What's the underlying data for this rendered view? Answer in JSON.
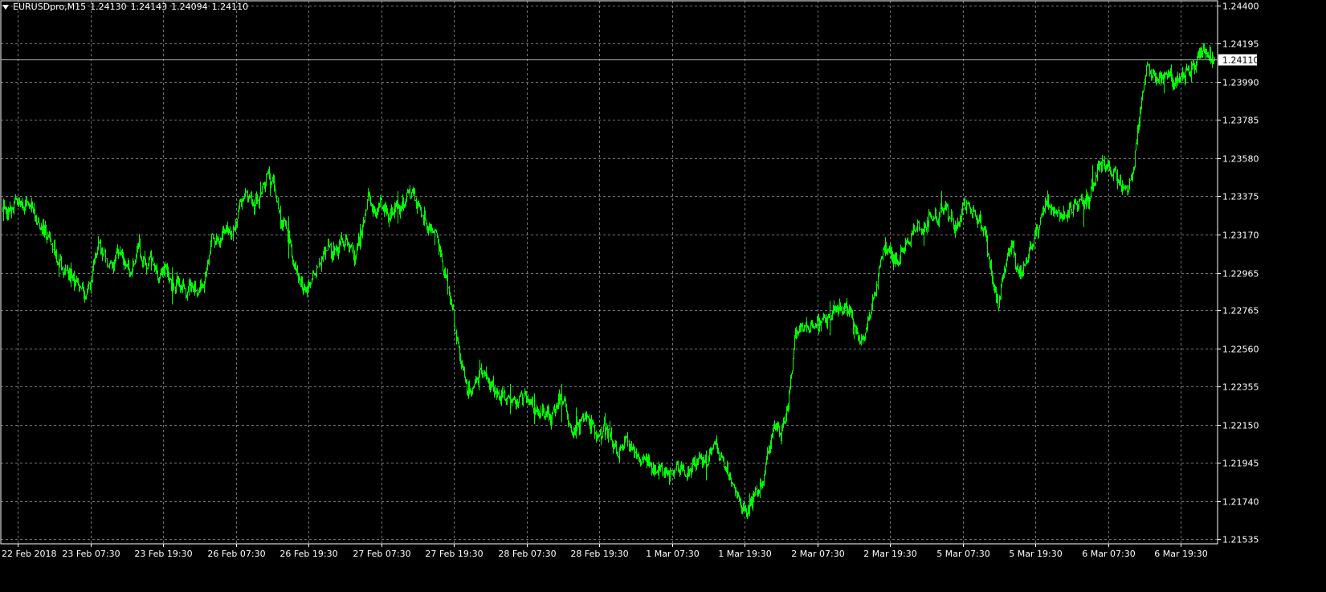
{
  "header": {
    "symbol": "EURUSDpro,M15",
    "open": "1.24130",
    "high": "1.24143",
    "low": "1.24094",
    "close": "1.24110",
    "menu_icon": "dropdown-triangle-icon"
  },
  "colors": {
    "background": "#000000",
    "bars": "#00ff00",
    "grid": "#c0c0c0",
    "axis_text": "#ffffff",
    "price_line": "#b0b8c0",
    "price_label_bg": "#ffffff",
    "price_label_text": "#000000"
  },
  "current_price": {
    "value": 1.2411,
    "label": "1.24110"
  },
  "chart_data": {
    "type": "line",
    "title": "EURUSDpro,M15",
    "xlabel": "",
    "ylabel": "",
    "ylim": [
      1.2151,
      1.24425
    ],
    "grid": true,
    "y_ticks": [
      "1.24400",
      "1.24195",
      "1.23990",
      "1.23785",
      "1.23580",
      "1.23375",
      "1.23170",
      "1.22965",
      "1.22765",
      "1.22560",
      "1.22355",
      "1.22150",
      "1.21945",
      "1.21740",
      "1.21535"
    ],
    "x_ticks": [
      "22 Feb 2018",
      "23 Feb 07:30",
      "23 Feb 19:30",
      "26 Feb 07:30",
      "26 Feb 19:30",
      "27 Feb 07:30",
      "27 Feb 19:30",
      "28 Feb 07:30",
      "28 Feb 19:30",
      "1 Mar 07:30",
      "1 Mar 19:30",
      "2 Mar 07:30",
      "2 Mar 19:30",
      "5 Mar 07:30",
      "5 Mar 19:30",
      "6 Mar 07:30",
      "6 Mar 19:30"
    ],
    "series": [
      {
        "values": [
          1.2332,
          1.2328,
          1.2336,
          1.2331,
          1.2335,
          1.2324,
          1.232,
          1.2315,
          1.2303,
          1.2298,
          1.2296,
          1.2291,
          1.2285,
          1.2291,
          1.2312,
          1.2306,
          1.2299,
          1.2308,
          1.2302,
          1.2296,
          1.231,
          1.23,
          1.2305,
          1.2294,
          1.2299,
          1.229,
          1.2292,
          1.2286,
          1.229,
          1.2286,
          1.2296,
          1.2316,
          1.2312,
          1.232,
          1.2316,
          1.2332,
          1.234,
          1.2333,
          1.2337,
          1.235,
          1.2344,
          1.2326,
          1.232,
          1.23,
          1.229,
          1.2287,
          1.2297,
          1.2303,
          1.231,
          1.2307,
          1.2315,
          1.2312,
          1.2305,
          1.2318,
          1.2337,
          1.2327,
          1.2335,
          1.2325,
          1.2332,
          1.2331,
          1.2341,
          1.2336,
          1.2328,
          1.232,
          1.2318,
          1.23,
          1.2285,
          1.2262,
          1.2243,
          1.223,
          1.224,
          1.2245,
          1.2236,
          1.2231,
          1.2231,
          1.2228,
          1.2227,
          1.2232,
          1.2226,
          1.2221,
          1.2222,
          1.2219,
          1.2228,
          1.2227,
          1.2211,
          1.2215,
          1.222,
          1.2214,
          1.2207,
          1.2215,
          1.2205,
          1.22,
          1.2208,
          1.2202,
          1.2196,
          1.2198,
          1.219,
          1.2192,
          1.2188,
          1.219,
          1.2192,
          1.2188,
          1.2194,
          1.2196,
          1.2195,
          1.2205,
          1.2198,
          1.219,
          1.2182,
          1.2172,
          1.2168,
          1.2178,
          1.218,
          1.22,
          1.2215,
          1.221,
          1.2225,
          1.2262,
          1.2267,
          1.2267,
          1.2268,
          1.2272,
          1.2272,
          1.2278,
          1.2276,
          1.2278,
          1.2264,
          1.2258,
          1.2273,
          1.2289,
          1.231,
          1.2307,
          1.2302,
          1.2309,
          1.2315,
          1.2322,
          1.2319,
          1.2327,
          1.2325,
          1.2333,
          1.2325,
          1.232,
          1.2334,
          1.233,
          1.2325,
          1.232,
          1.2297,
          1.2278,
          1.23,
          1.2312,
          1.2295,
          1.23,
          1.2312,
          1.2322,
          1.2335,
          1.233,
          1.2328,
          1.2327,
          1.2332,
          1.2335,
          1.2334,
          1.2342,
          1.2355,
          1.2353,
          1.2351,
          1.2344,
          1.234,
          1.2352,
          1.2385,
          1.2408,
          1.2403,
          1.24,
          1.2405,
          1.2398,
          1.2402,
          1.2403,
          1.2408,
          1.2417,
          1.2413,
          1.2411
        ]
      }
    ]
  }
}
